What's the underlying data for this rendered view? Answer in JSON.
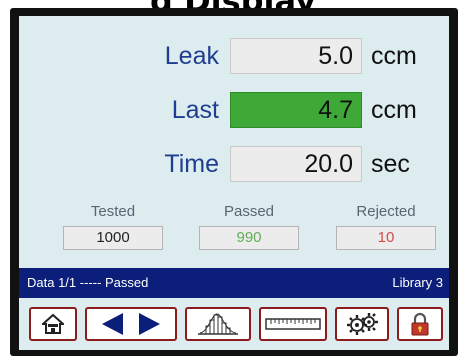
{
  "header_title": "g Display",
  "readings": {
    "leak": {
      "label": "Leak",
      "value": "5.0",
      "unit": "ccm"
    },
    "last": {
      "label": "Last",
      "value": "4.7",
      "unit": "ccm"
    },
    "time": {
      "label": "Time",
      "value": "20.0",
      "unit": "sec"
    }
  },
  "counts": {
    "tested": {
      "label": "Tested",
      "value": "1000"
    },
    "passed": {
      "label": "Passed",
      "value": "990"
    },
    "rejected": {
      "label": "Rejected",
      "value": "10"
    }
  },
  "status": {
    "left": "Data 1/1 ----- Passed",
    "right": "Library 3"
  },
  "colors": {
    "label_blue": "#1f3e91",
    "highlight_green": "#3ea936",
    "passed_text": "#5fae56",
    "rejected_text": "#d24b4b",
    "status_bar": "#0b1f7a",
    "button_border": "#8a1c1c"
  },
  "toolbar": {
    "icons": [
      "home-icon",
      "previous-icon",
      "next-icon",
      "histogram-icon",
      "ruler-icon",
      "settings-icon",
      "lock-icon"
    ]
  }
}
